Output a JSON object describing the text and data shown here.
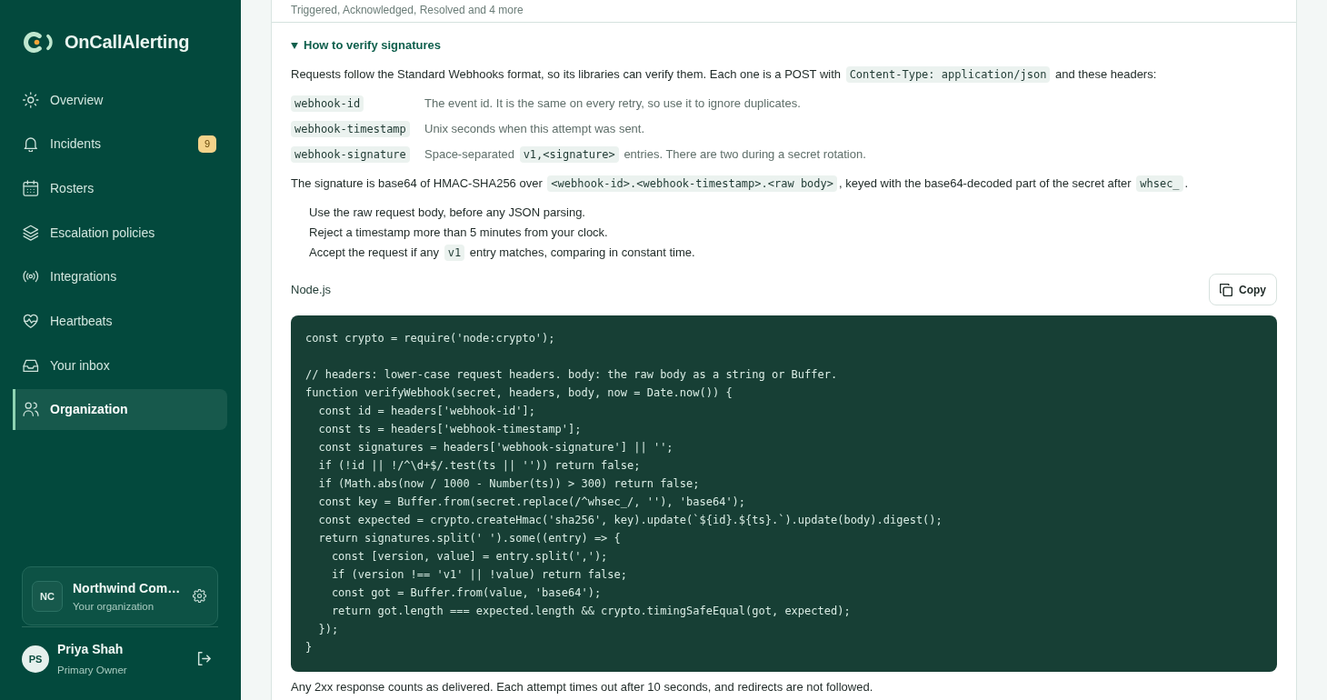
{
  "sidebar": {
    "logo": {
      "text": "OnCallAlerting"
    },
    "nav": [
      {
        "label": "Overview",
        "selected": false
      },
      {
        "label": "Incidents",
        "selected": false,
        "badge": "9"
      },
      {
        "label": "Rosters",
        "selected": false
      },
      {
        "label": "Escalation policies",
        "selected": false
      },
      {
        "label": "Integrations",
        "selected": false
      },
      {
        "label": "Heartbeats",
        "selected": false
      },
      {
        "label": "Your inbox",
        "selected": false
      },
      {
        "label": "Organization",
        "selected": true
      }
    ],
    "organization": {
      "initials": "NC",
      "name": "Northwind Com…",
      "role": "Your organization"
    },
    "user": {
      "initials": "PS",
      "name": "Priya Shah",
      "role": "Primary Owner"
    }
  },
  "main": {
    "previous_section_text": "Triggered, Acknowledged, Resolved and 4 more",
    "verify_section": {
      "title": "How to verify signatures",
      "expanded": true,
      "intro": [
        {
          "kind": "text",
          "text": "Requests follow the Standard Webhooks format, so its libraries can verify them. Each one is a POST with "
        },
        {
          "kind": "code",
          "text": "Content-Type: application/json"
        },
        {
          "kind": "text",
          "text": " and these headers:"
        }
      ],
      "headers": [
        {
          "name": "webhook-id",
          "description": [
            {
              "kind": "text",
              "text": "The event id. It is the same on every retry, so use it to ignore duplicates."
            }
          ]
        },
        {
          "name": "webhook-timestamp",
          "description": [
            {
              "kind": "text",
              "text": "Unix seconds when this attempt was sent."
            }
          ]
        },
        {
          "name": "webhook-signature",
          "description": [
            {
              "kind": "text",
              "text": "Space-separated "
            },
            {
              "kind": "code",
              "text": "v1,<signature>"
            },
            {
              "kind": "text",
              "text": " entries. There are two during a secret rotation."
            }
          ]
        }
      ],
      "signature_note": [
        {
          "kind": "text",
          "text": "The signature is base64 of HMAC-SHA256 over "
        },
        {
          "kind": "code",
          "text": "<webhook-id>.<webhook-timestamp>.<raw body>"
        },
        {
          "kind": "text",
          "text": ", keyed with the base64-decoded part of the secret after "
        },
        {
          "kind": "code",
          "text": "whsec_"
        },
        {
          "kind": "text",
          "text": "."
        }
      ],
      "steps": [
        [
          {
            "kind": "text",
            "text": "Use the raw request body, before any JSON parsing."
          }
        ],
        [
          {
            "kind": "text",
            "text": "Reject a timestamp more than 5 minutes from your clock."
          }
        ],
        [
          {
            "kind": "text",
            "text": "Accept the request if any "
          },
          {
            "kind": "code",
            "text": "v1"
          },
          {
            "kind": "text",
            "text": " entry matches, comparing in constant time."
          }
        ]
      ],
      "code_label": "Node.js",
      "copy_button": "Copy",
      "code": "const crypto = require('node:crypto');\n\n// headers: lower-case request headers. body: the raw body as a string or Buffer.\nfunction verifyWebhook(secret, headers, body, now = Date.now()) {\n  const id = headers['webhook-id'];\n  const ts = headers['webhook-timestamp'];\n  const signatures = headers['webhook-signature'] || '';\n  if (!id || !/^\\d+$/.test(ts || '')) return false;\n  if (Math.abs(now / 1000 - Number(ts)) > 300) return false;\n  const key = Buffer.from(secret.replace(/^whsec_/, ''), 'base64');\n  const expected = crypto.createHmac('sha256', key).update(`${id}.${ts}.`).update(body).digest();\n  return signatures.split(' ').some((entry) => {\n    const [version, value] = entry.split(',');\n    if (version !== 'v1' || !value) return false;\n    const got = Buffer.from(value, 'base64');\n    return got.length === expected.length && crypto.timingSafeEqual(got, expected);\n  });\n}",
      "footer_note": "Any 2xx response counts as delivered. Each attempt times out after 10 seconds, and redirects are not followed."
    }
  }
}
